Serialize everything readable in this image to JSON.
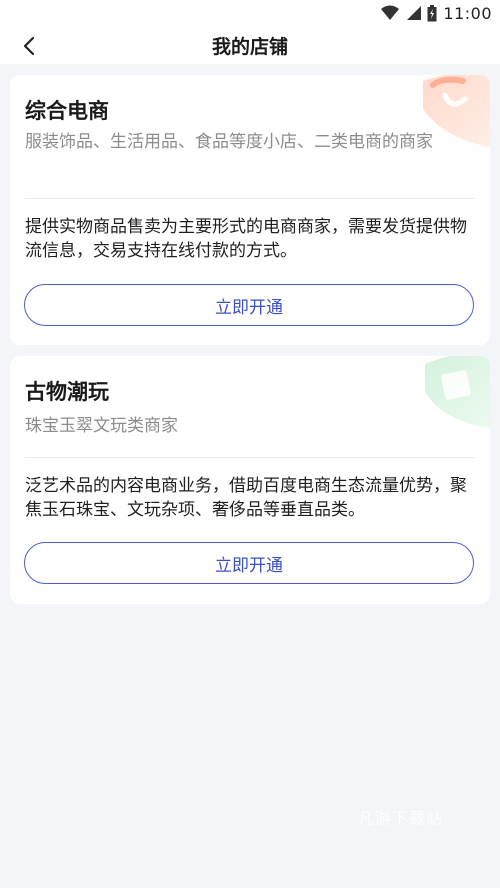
{
  "status_bar": {
    "time": "11:00"
  },
  "header": {
    "title": "我的店铺",
    "back_icon": "chevron-left-icon"
  },
  "stores": [
    {
      "title": "综合电商",
      "subtitle": "服装饰品、生活用品、食品等度小店、二类电商的商家",
      "description": "提供实物商品售卖为主要形式的电商商家，需要发货提供物流信息，交易支持在线付款的方式。",
      "button_label": "立即开通",
      "accent_color": "#ff8a66"
    },
    {
      "title": "古物潮玩",
      "subtitle": "珠宝玉翠文玩类商家",
      "description": "泛艺术品的内容电商业务，借助百度电商生态流量优势，聚焦玉石珠宝、文玩杂项、奢侈品等垂直品类。",
      "button_label": "立即开通",
      "accent_color": "#7fd49a"
    }
  ],
  "watermark": "凡游下载站",
  "colors": {
    "button_border": "#4a5fd0",
    "button_text": "#3b4fc4",
    "background": "#f4f5f8"
  }
}
